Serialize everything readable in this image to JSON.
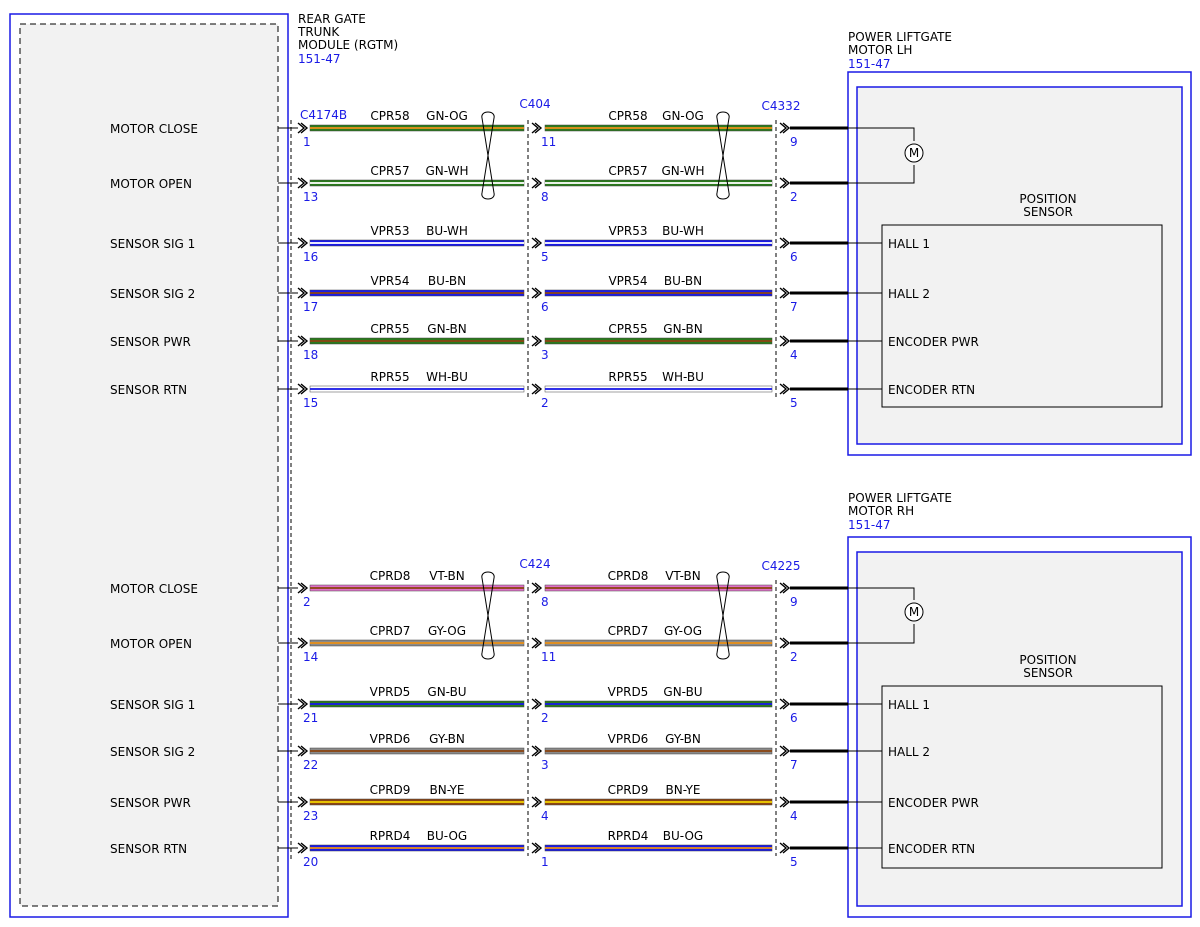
{
  "module": {
    "title_lines": [
      "REAR GATE",
      "TRUNK",
      "MODULE (RGTM)"
    ],
    "ref": "151-47"
  },
  "colors": {
    "frame": "#1a1ae6",
    "inner_fill": "#f2f2f2",
    "GN": "#2a7a1c",
    "OG": "#e8901a",
    "WH": "#ffffff",
    "BU": "#1a1ae6",
    "BN": "#8b4513",
    "VT": "#e070c8",
    "GY": "#8a8a8a",
    "YE": "#f0d000"
  },
  "groups": [
    {
      "id": "lh",
      "component": {
        "title_lines": [
          "POWER LIFTGATE",
          "MOTOR LH"
        ],
        "ref": "151-47"
      },
      "connectors": {
        "module": "C4174B",
        "inline": "C404",
        "component": "C4332"
      },
      "sensor_title_lines": [
        "POSITION",
        "SENSOR"
      ],
      "motor_symbol": "M",
      "circuits": [
        {
          "signal": "MOTOR CLOSE",
          "circuit": "CPR58",
          "color": "GN-OG",
          "pin_module": "1",
          "pin_inline": "11",
          "pin_component": "9",
          "terminal": ""
        },
        {
          "signal": "MOTOR OPEN",
          "circuit": "CPR57",
          "color": "GN-WH",
          "pin_module": "13",
          "pin_inline": "8",
          "pin_component": "2",
          "terminal": ""
        },
        {
          "signal": "SENSOR SIG 1",
          "circuit": "VPR53",
          "color": "BU-WH",
          "pin_module": "16",
          "pin_inline": "5",
          "pin_component": "6",
          "terminal": "HALL 1"
        },
        {
          "signal": "SENSOR SIG 2",
          "circuit": "VPR54",
          "color": "BU-BN",
          "pin_module": "17",
          "pin_inline": "6",
          "pin_component": "7",
          "terminal": "HALL 2"
        },
        {
          "signal": "SENSOR PWR",
          "circuit": "CPR55",
          "color": "GN-BN",
          "pin_module": "18",
          "pin_inline": "3",
          "pin_component": "4",
          "terminal": "ENCODER PWR"
        },
        {
          "signal": "SENSOR RTN",
          "circuit": "RPR55",
          "color": "WH-BU",
          "pin_module": "15",
          "pin_inline": "2",
          "pin_component": "5",
          "terminal": "ENCODER RTN"
        }
      ]
    },
    {
      "id": "rh",
      "component": {
        "title_lines": [
          "POWER LIFTGATE",
          "MOTOR RH"
        ],
        "ref": "151-47"
      },
      "connectors": {
        "module": "",
        "inline": "C424",
        "component": "C4225"
      },
      "sensor_title_lines": [
        "POSITION",
        "SENSOR"
      ],
      "motor_symbol": "M",
      "circuits": [
        {
          "signal": "MOTOR CLOSE",
          "circuit": "CPRD8",
          "color": "VT-BN",
          "pin_module": "2",
          "pin_inline": "8",
          "pin_component": "9",
          "terminal": ""
        },
        {
          "signal": "MOTOR OPEN",
          "circuit": "CPRD7",
          "color": "GY-OG",
          "pin_module": "14",
          "pin_inline": "11",
          "pin_component": "2",
          "terminal": ""
        },
        {
          "signal": "SENSOR SIG 1",
          "circuit": "VPRD5",
          "color": "GN-BU",
          "pin_module": "21",
          "pin_inline": "2",
          "pin_component": "6",
          "terminal": "HALL 1"
        },
        {
          "signal": "SENSOR SIG 2",
          "circuit": "VPRD6",
          "color": "GY-BN",
          "pin_module": "22",
          "pin_inline": "3",
          "pin_component": "7",
          "terminal": "HALL 2"
        },
        {
          "signal": "SENSOR PWR",
          "circuit": "CPRD9",
          "color": "BN-YE",
          "pin_module": "23",
          "pin_inline": "4",
          "pin_component": "4",
          "terminal": "ENCODER PWR"
        },
        {
          "signal": "SENSOR RTN",
          "circuit": "RPRD4",
          "color": "BU-OG",
          "pin_module": "20",
          "pin_inline": "1",
          "pin_component": "5",
          "terminal": "ENCODER RTN"
        }
      ]
    }
  ]
}
